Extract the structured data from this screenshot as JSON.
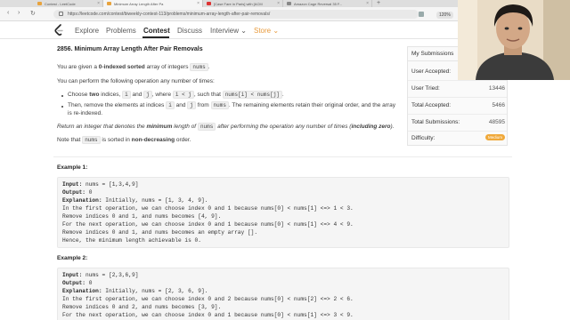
{
  "browser": {
    "tabs": [
      {
        "label": "Contest - LeetCode"
      },
      {
        "label": "Minimum Array Length After Pa"
      },
      {
        "label": "[Case Fare in Paris] with [ACM"
      },
      {
        "label": "Amazon Cage Reversal 35 F..."
      }
    ],
    "new_tab": "+",
    "url": "https://leetcode.com/contest/biweekly-contest-113/problems/minimum-array-length-after-pair-removals/",
    "zoom": "120%"
  },
  "nav": {
    "items": [
      "Explore",
      "Problems",
      "Contest",
      "Discuss",
      "Interview",
      "Store"
    ]
  },
  "problem": {
    "title": "2856. Minimum Array Length After Pair Removals",
    "p1_pre": "You are given a ",
    "p1_bold": "0-indexed sorted",
    "p1_mid": " array of integers ",
    "p1_code": "nums",
    "p1_post": ".",
    "p2": "You can perform the following operation any number of times:",
    "b1_pre": "Choose ",
    "b1_bold": "two",
    "b1_mid1": " indices, ",
    "b1_code1": "i",
    "b1_and": " and ",
    "b1_code2": "j",
    "b1_mid2": ", where ",
    "b1_code3": "i < j",
    "b1_mid3": ", such that ",
    "b1_code4": "nums[i] < nums[j]",
    "b1_post": ".",
    "b2_pre": "Then, remove the elements at indices ",
    "b2_code1": "i",
    "b2_and": " and ",
    "b2_code2": "j",
    "b2_mid": " from ",
    "b2_code3": "nums",
    "b2_post": ". The remaining elements retain their original order, and the array",
    "b2_line2": "is re-indexed.",
    "ret_pre": "Return an integer that denotes the ",
    "ret_bold": "minimum",
    "ret_mid": " length of ",
    "ret_code": "nums",
    "ret_post": " after performing the operation any number of times (",
    "ret_bold2": "including zero",
    "ret_end": ").",
    "note_pre": "Note that ",
    "note_code": "nums",
    "note_mid": " is sorted in ",
    "note_bold": "non-decreasing",
    "note_post": " order."
  },
  "example1": {
    "title": "Example 1:",
    "input_label": "Input:",
    "input": " nums = [1,3,4,9]",
    "output_label": "Output:",
    "output": " 0",
    "expl_label": "Explanation:",
    "expl": " Initially, nums = [1, 3, 4, 9].",
    "l1": "In the first operation, we can choose index 0 and 1 because nums[0] < nums[1] <=> 1 < 3.",
    "l2": "Remove indices 0 and 1, and nums becomes [4, 9].",
    "l3": "For the next operation, we can choose index 0 and 1 because nums[0] < nums[1] <=> 4 < 9.",
    "l4": "Remove indices 0 and 1, and nums becomes an empty array [].",
    "l5": "Hence, the minimum length achievable is 0."
  },
  "example2": {
    "title": "Example 2:",
    "input_label": "Input:",
    "input": " nums = [2,3,6,9]",
    "output_label": "Output:",
    "output": " 0",
    "expl_label": "Explanation:",
    "expl": " Initially, nums = [2, 3, 6, 9].",
    "l1": "In the first operation, we can choose index 0 and 2 because nums[0] < nums[2] <=> 2 < 6.",
    "l2": "Remove indices 0 and 2, and nums becomes [3, 9].",
    "l3": "For the next operation, we can choose index 0 and 1 because nums[0] < nums[1] <=> 3 < 9."
  },
  "stats": {
    "my_submissions": "My Submissions",
    "user_accepted_label": "User Accepted:",
    "user_tried_label": "User Tried:",
    "user_tried": "13446",
    "total_accepted_label": "Total Accepted:",
    "total_accepted": "5466",
    "total_submissions_label": "Total Submissions:",
    "total_submissions": "48595",
    "difficulty_label": "Difficulty:",
    "difficulty": "Medium"
  },
  "colors": {
    "accent": "#e89a3c",
    "difficulty": "#f0a93a"
  }
}
